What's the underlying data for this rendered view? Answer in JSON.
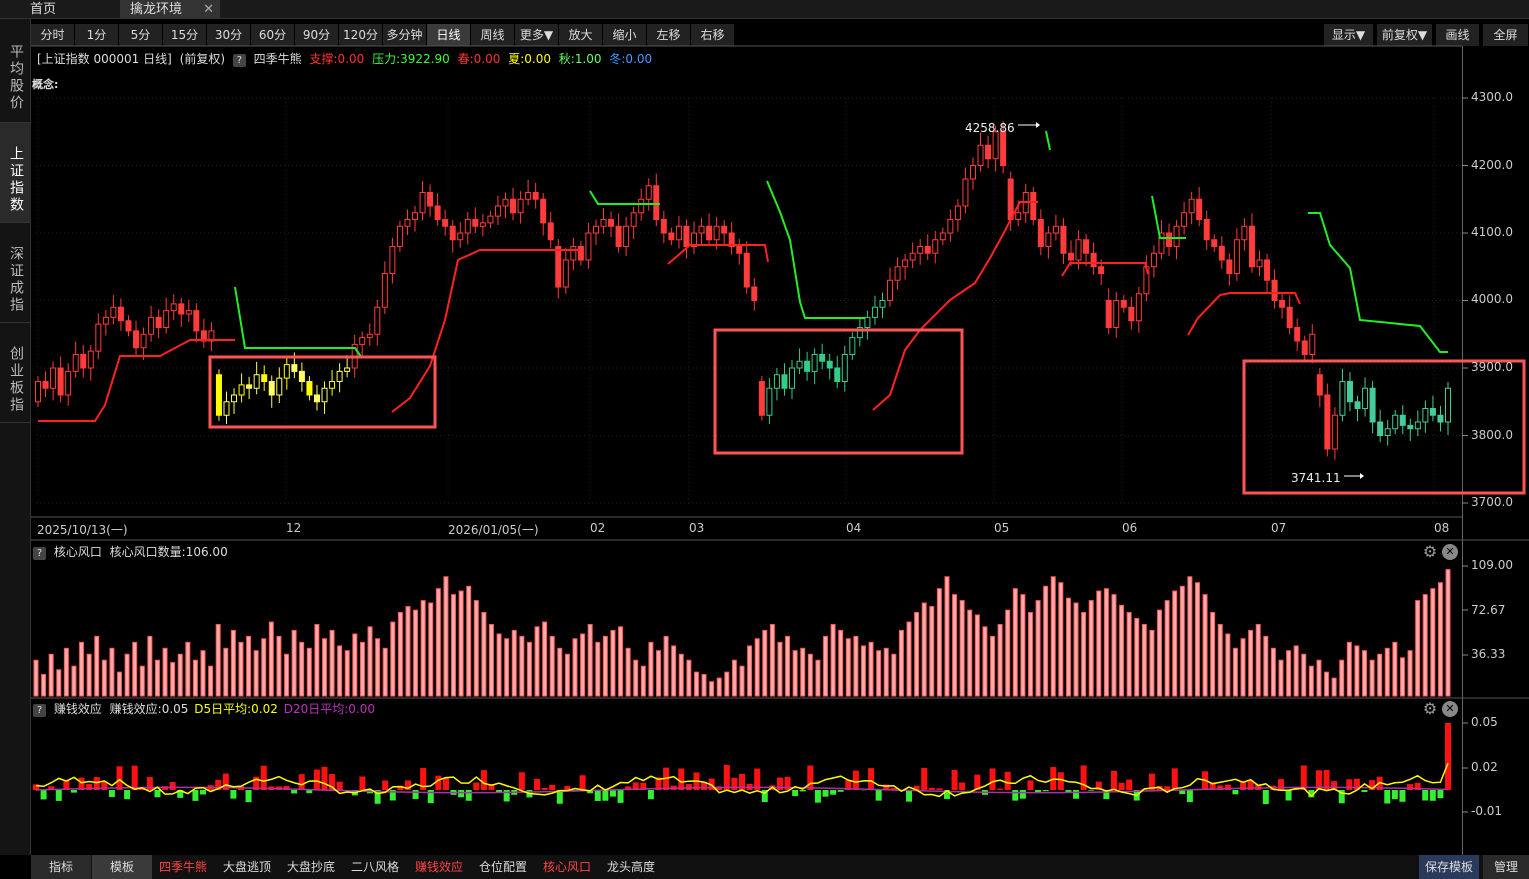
{
  "tabs": [
    {
      "label": "首页"
    },
    {
      "label": "擒龙环境"
    }
  ],
  "sidebar": {
    "items": [
      {
        "label": "平均股价"
      },
      {
        "label": "上证指数"
      },
      {
        "label": "深证成指"
      },
      {
        "label": "创业板指"
      }
    ]
  },
  "toolbar": {
    "periods": [
      "分时",
      "1分",
      "5分",
      "15分",
      "30分",
      "60分",
      "90分",
      "120分",
      "多分钟",
      "日线",
      "周线",
      "更多▼"
    ],
    "actions": [
      "放大",
      "缩小",
      "左移",
      "右移"
    ],
    "right": [
      "显示▼",
      "前复权▼",
      "画线",
      "全屏"
    ],
    "active_period": "日线"
  },
  "main_chart": {
    "title": "[上证指数 000001 日线]",
    "adjust": "(前复权)",
    "help": "?",
    "indicator": "四季牛熊",
    "support": "支撑:0.00",
    "pressure": "压力:3922.90",
    "spring": "春:0.00",
    "summer": "夏:0.00",
    "autumn": "秋:1.00",
    "winter": "冬:0.00",
    "concept": "概念:",
    "y_ticks": [
      "4300.0",
      "4200.0",
      "4100.0",
      "4000.0",
      "3900.0",
      "3800.0",
      "3700.0"
    ],
    "x_ticks": [
      "2025/10/13(一)",
      "12",
      "2026/01/05(一)",
      "02",
      "03",
      "04",
      "05",
      "06",
      "07",
      "08"
    ],
    "high_label": "4258.86",
    "low_label": "3741.11"
  },
  "panel_wind": {
    "help": "?",
    "name": "核心风口",
    "field": "核心风口数量:106.00",
    "y_ticks": [
      "109.00",
      "72.67",
      "36.33"
    ]
  },
  "panel_money": {
    "help": "?",
    "name": "赚钱效应",
    "field": "赚钱效应:0.05",
    "d5": "D5日平均:0.02",
    "d20": "D20日平均:0.00",
    "y_ticks": [
      "0.05",
      "0.02",
      "-0.01"
    ]
  },
  "bottom": {
    "left": [
      "指标",
      "模板"
    ],
    "items": [
      "四季牛熊",
      "大盘逃顶",
      "大盘抄底",
      "二八风格",
      "赚钱效应",
      "仓位配置",
      "核心风口",
      "龙头高度"
    ],
    "right": [
      "保存模板",
      "管理"
    ]
  },
  "chart_data": {
    "type": "candlestick",
    "candles": [
      [
        3850,
        3880
      ],
      [
        3880,
        3870
      ],
      [
        3870,
        3900
      ],
      [
        3900,
        3860
      ],
      [
        3860,
        3895
      ],
      [
        3895,
        3920
      ],
      [
        3920,
        3900
      ],
      [
        3900,
        3925
      ],
      [
        3925,
        3965
      ],
      [
        3965,
        3975
      ],
      [
        3975,
        3990
      ],
      [
        3990,
        3970
      ],
      [
        3970,
        3955
      ],
      [
        3955,
        3930
      ],
      [
        3930,
        3950
      ],
      [
        3950,
        3975
      ],
      [
        3975,
        3960
      ],
      [
        3960,
        3985
      ],
      [
        3985,
        3995
      ],
      [
        3995,
        3980
      ],
      [
        3980,
        3985
      ],
      [
        3985,
        3955
      ],
      [
        3955,
        3940
      ],
      [
        3940,
        3955
      ],
      [
        3890,
        3830
      ],
      [
        3830,
        3850
      ],
      [
        3850,
        3860
      ],
      [
        3860,
        3875
      ],
      [
        3875,
        3870
      ],
      [
        3870,
        3890
      ],
      [
        3890,
        3880
      ],
      [
        3880,
        3860
      ],
      [
        3860,
        3885
      ],
      [
        3885,
        3905
      ],
      [
        3905,
        3895
      ],
      [
        3895,
        3880
      ],
      [
        3880,
        3860
      ],
      [
        3860,
        3850
      ],
      [
        3850,
        3870
      ],
      [
        3870,
        3880
      ],
      [
        3880,
        3895
      ],
      [
        3895,
        3900
      ],
      [
        3900,
        3935
      ],
      [
        3935,
        3945
      ],
      [
        3945,
        3950
      ],
      [
        3950,
        3990
      ],
      [
        3990,
        4040
      ],
      [
        4040,
        4080
      ],
      [
        4080,
        4110
      ],
      [
        4110,
        4120
      ],
      [
        4120,
        4130
      ],
      [
        4130,
        4160
      ],
      [
        4160,
        4140
      ],
      [
        4140,
        4120
      ],
      [
        4120,
        4110
      ],
      [
        4110,
        4090
      ],
      [
        4090,
        4100
      ],
      [
        4100,
        4120
      ],
      [
        4120,
        4110
      ],
      [
        4110,
        4115
      ],
      [
        4115,
        4125
      ],
      [
        4125,
        4140
      ],
      [
        4140,
        4150
      ],
      [
        4150,
        4130
      ],
      [
        4130,
        4150
      ],
      [
        4150,
        4160
      ],
      [
        4160,
        4150
      ],
      [
        4150,
        4115
      ],
      [
        4115,
        4090
      ],
      [
        4080,
        4020
      ],
      [
        4020,
        4060
      ],
      [
        4060,
        4080
      ],
      [
        4080,
        4060
      ],
      [
        4060,
        4100
      ],
      [
        4100,
        4110
      ],
      [
        4110,
        4120
      ],
      [
        4120,
        4110
      ],
      [
        4110,
        4080
      ],
      [
        4080,
        4110
      ],
      [
        4110,
        4130
      ],
      [
        4130,
        4150
      ],
      [
        4150,
        4170
      ],
      [
        4170,
        4120
      ],
      [
        4120,
        4100
      ],
      [
        4100,
        4090
      ],
      [
        4090,
        4110
      ],
      [
        4110,
        4080
      ],
      [
        4080,
        4100
      ],
      [
        4100,
        4110
      ],
      [
        4110,
        4090
      ],
      [
        4090,
        4110
      ],
      [
        4110,
        4100
      ],
      [
        4100,
        4080
      ],
      [
        4080,
        4070
      ],
      [
        4070,
        4020
      ],
      [
        4020,
        4000
      ],
      [
        3880,
        3830
      ],
      [
        3830,
        3870
      ],
      [
        3870,
        3890
      ],
      [
        3890,
        3870
      ],
      [
        3870,
        3900
      ],
      [
        3900,
        3910
      ],
      [
        3910,
        3895
      ],
      [
        3895,
        3920
      ],
      [
        3920,
        3910
      ],
      [
        3910,
        3900
      ],
      [
        3900,
        3880
      ],
      [
        3880,
        3920
      ],
      [
        3920,
        3945
      ],
      [
        3945,
        3960
      ],
      [
        3960,
        3975
      ],
      [
        3975,
        3990
      ],
      [
        3990,
        4000
      ],
      [
        4000,
        4030
      ],
      [
        4030,
        4050
      ],
      [
        4050,
        4060
      ],
      [
        4060,
        4070
      ],
      [
        4070,
        4080
      ],
      [
        4080,
        4070
      ],
      [
        4070,
        4090
      ],
      [
        4090,
        4100
      ],
      [
        4100,
        4120
      ],
      [
        4120,
        4140
      ],
      [
        4140,
        4180
      ],
      [
        4180,
        4200
      ],
      [
        4200,
        4230
      ],
      [
        4230,
        4210
      ],
      [
        4210,
        4250
      ],
      [
        4250,
        4200
      ],
      [
        4180,
        4120
      ],
      [
        4120,
        4130
      ],
      [
        4130,
        4160
      ],
      [
        4160,
        4120
      ],
      [
        4120,
        4080
      ],
      [
        4080,
        4100
      ],
      [
        4100,
        4110
      ],
      [
        4110,
        4070
      ],
      [
        4070,
        4060
      ],
      [
        4060,
        4090
      ],
      [
        4090,
        4070
      ],
      [
        4070,
        4050
      ],
      [
        4050,
        4040
      ],
      [
        4000,
        3960
      ],
      [
        3960,
        4000
      ],
      [
        4000,
        3990
      ],
      [
        3990,
        3970
      ],
      [
        3970,
        4010
      ],
      [
        4010,
        4050
      ],
      [
        4050,
        4070
      ],
      [
        4070,
        4100
      ],
      [
        4100,
        4080
      ],
      [
        4080,
        4110
      ],
      [
        4110,
        4130
      ],
      [
        4130,
        4150
      ],
      [
        4150,
        4120
      ],
      [
        4120,
        4090
      ],
      [
        4090,
        4080
      ],
      [
        4080,
        4060
      ],
      [
        4060,
        4040
      ],
      [
        4040,
        4090
      ],
      [
        4090,
        4110
      ],
      [
        4110,
        4050
      ],
      [
        4050,
        4060
      ],
      [
        4060,
        4030
      ],
      [
        4030,
        4000
      ],
      [
        4000,
        3990
      ],
      [
        3990,
        3960
      ],
      [
        3960,
        3940
      ],
      [
        3940,
        3920
      ],
      [
        3920,
        3950
      ],
      [
        3890,
        3860
      ],
      [
        3860,
        3780
      ],
      [
        3780,
        3830
      ],
      [
        3830,
        3880
      ],
      [
        3880,
        3850
      ],
      [
        3850,
        3840
      ],
      [
        3840,
        3870
      ],
      [
        3870,
        3820
      ],
      [
        3820,
        3800
      ],
      [
        3800,
        3810
      ],
      [
        3810,
        3830
      ],
      [
        3830,
        3815
      ],
      [
        3815,
        3810
      ],
      [
        3810,
        3820
      ],
      [
        3820,
        3840
      ],
      [
        3840,
        3830
      ],
      [
        3830,
        3820
      ],
      [
        3820,
        3870
      ]
    ],
    "wind_counts": [
      30,
      18,
      35,
      22,
      40,
      25,
      45,
      35,
      50,
      30,
      40,
      20,
      35,
      45,
      25,
      50,
      30,
      40,
      28,
      35,
      45,
      30,
      38,
      25,
      60,
      40,
      55,
      45,
      50,
      38,
      48,
      62,
      50,
      35,
      55,
      45,
      40,
      60,
      48,
      55,
      42,
      38,
      52,
      45,
      58,
      48,
      40,
      62,
      70,
      75,
      72,
      80,
      78,
      90,
      100,
      85,
      88,
      92,
      80,
      70,
      60,
      52,
      48,
      55,
      50,
      45,
      58,
      62,
      50,
      40,
      35,
      48,
      52,
      60,
      45,
      50,
      55,
      58,
      40,
      30,
      25,
      45,
      38,
      50,
      42,
      35,
      30,
      20,
      18,
      12,
      15,
      20,
      30,
      25,
      42,
      48,
      55,
      60,
      45,
      50,
      38,
      40,
      35,
      30,
      50,
      60,
      55,
      48,
      50,
      42,
      45,
      38,
      40,
      35,
      55,
      62,
      70,
      78,
      75,
      90,
      100,
      85,
      80,
      72,
      68,
      58,
      50,
      60,
      72,
      90,
      85,
      70,
      80,
      92,
      100,
      95,
      82,
      78,
      70,
      80,
      88,
      90,
      85,
      76,
      70,
      65,
      60,
      55,
      72,
      80,
      88,
      92,
      100,
      95,
      85,
      70,
      60,
      52,
      40,
      48,
      55,
      60,
      50,
      40,
      30,
      38,
      42,
      35,
      25,
      30,
      20,
      15,
      30,
      45,
      42,
      38,
      30,
      35,
      40,
      45,
      32,
      38,
      80,
      85,
      90,
      95,
      106
    ]
  }
}
